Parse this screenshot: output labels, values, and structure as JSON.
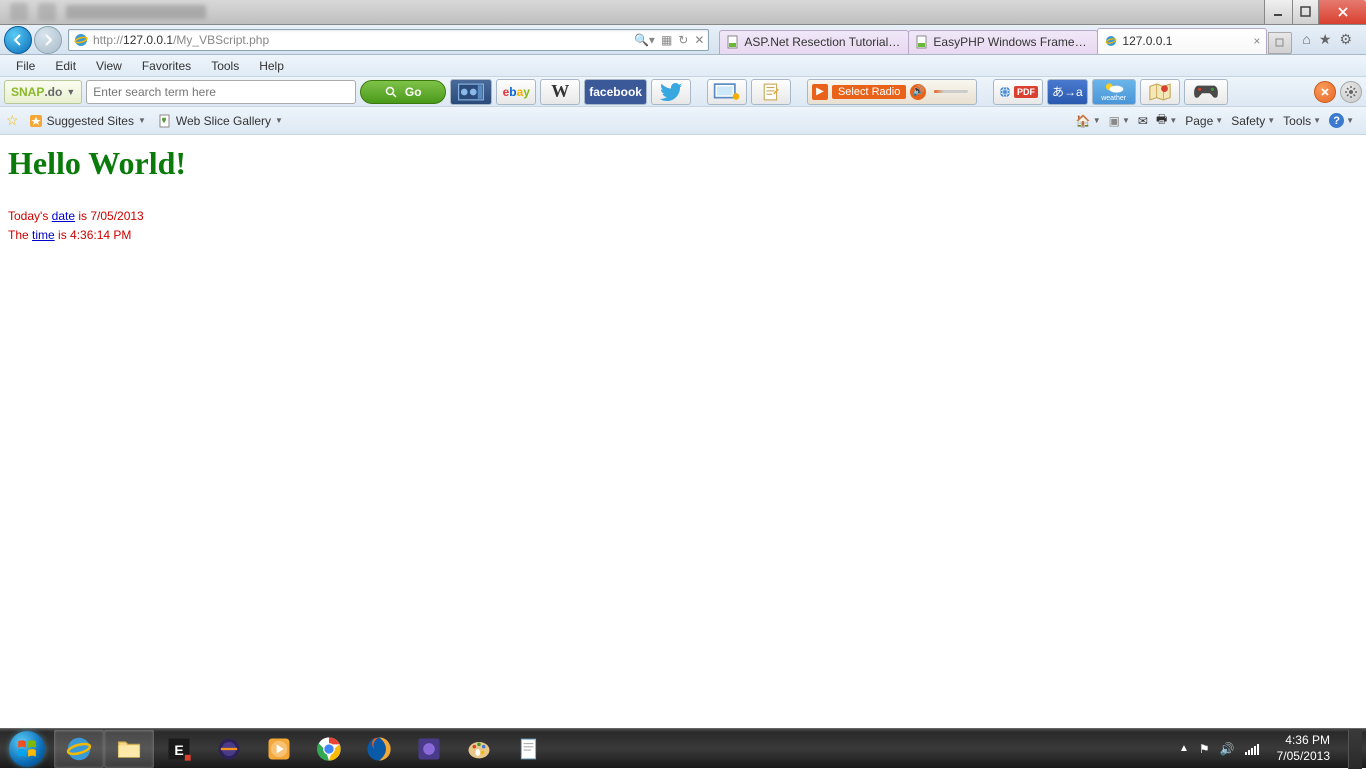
{
  "titlebar": {},
  "nav": {
    "url_grey1": "http://",
    "url_bold": "127.0.0.1",
    "url_grey2": "/My_VBScript.php"
  },
  "tabs": [
    {
      "label": "ASP.Net Resection Tutorial | ...",
      "icon": "page"
    },
    {
      "label": "EasyPHP Windows Framewor...",
      "icon": "page"
    },
    {
      "label": "127.0.0.1",
      "icon": "ie",
      "active": true
    }
  ],
  "menu": [
    "File",
    "Edit",
    "View",
    "Favorites",
    "Tools",
    "Help"
  ],
  "snapdo": {
    "brand1": "SNAP",
    "brand2": ".do"
  },
  "search": {
    "placeholder": "Enter search term here"
  },
  "go": {
    "label": "Go"
  },
  "radio": {
    "label": "Select Radio"
  },
  "translate": {
    "label": "あ→a"
  },
  "weather": {
    "label": "weather"
  },
  "favbar": {
    "suggested": "Suggested Sites",
    "webslice": "Web Slice Gallery"
  },
  "cmdbar": {
    "page": "Page",
    "safety": "Safety",
    "tools": "Tools"
  },
  "page": {
    "heading": "Hello World!",
    "line1_a": "Today's ",
    "line1_link": "date",
    "line1_b": " is 7/05/2013",
    "line2_a": "The ",
    "line2_link": "time",
    "line2_b": " is 4:36:14 PM"
  },
  "tray": {
    "time": "4:36 PM",
    "date": "7/05/2013"
  }
}
